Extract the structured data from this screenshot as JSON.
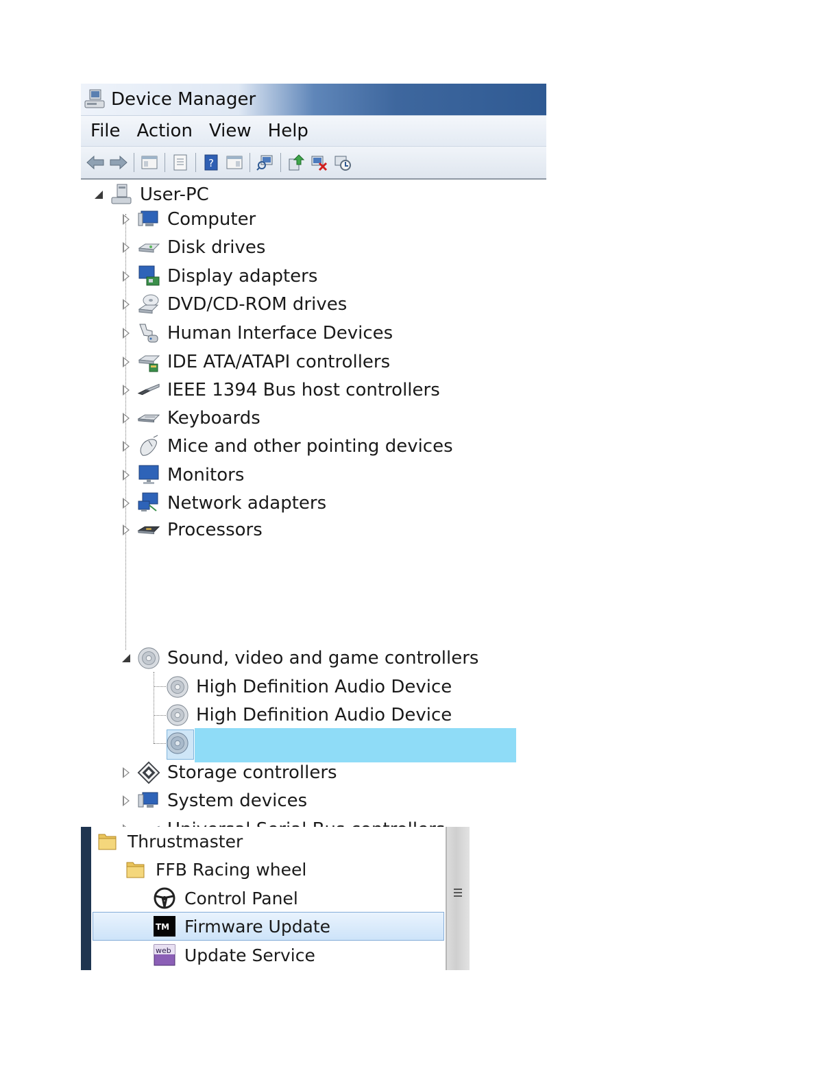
{
  "window": {
    "title": "Device Manager",
    "menu": [
      "File",
      "Action",
      "View",
      "Help"
    ],
    "toolbar_icons": [
      "back-arrow-icon",
      "forward-arrow-icon",
      "show-hide-console-tree-icon",
      "properties-icon",
      "help-icon",
      "action-pane-icon",
      "scan-hardware-icon",
      "update-driver-icon",
      "uninstall-icon",
      "disable-device-icon"
    ]
  },
  "tree": {
    "root": "User-PC",
    "categories": [
      {
        "label": "Computer",
        "icon": "computer-icon"
      },
      {
        "label": "Disk drives",
        "icon": "disk-drive-icon"
      },
      {
        "label": "Display adapters",
        "icon": "display-adapter-icon"
      },
      {
        "label": "DVD/CD-ROM drives",
        "icon": "dvd-drive-icon"
      },
      {
        "label": "Human Interface Devices",
        "icon": "hid-icon"
      },
      {
        "label": "IDE ATA/ATAPI controllers",
        "icon": "ide-controller-icon"
      },
      {
        "label": "IEEE 1394 Bus host controllers",
        "icon": "ieee1394-icon"
      },
      {
        "label": "Keyboards",
        "icon": "keyboard-icon"
      },
      {
        "label": "Mice and other pointing devices",
        "icon": "mouse-icon"
      },
      {
        "label": "Monitors",
        "icon": "monitor-icon"
      },
      {
        "label": "Network adapters",
        "icon": "network-adapter-icon"
      },
      {
        "label": "Processors",
        "icon": "processor-icon"
      },
      {
        "label": "Sound, video and game controllers",
        "icon": "speaker-icon",
        "expanded": true
      },
      {
        "label": "Storage controllers",
        "icon": "storage-controller-icon"
      },
      {
        "label": "System devices",
        "icon": "system-device-icon"
      },
      {
        "label": "Universal Serial Bus controllers",
        "icon": "usb-icon"
      }
    ],
    "sound_children": [
      "High Definition Audio Device",
      "High Definition Audio Device",
      ""
    ],
    "selection_color": "#8fdcf7"
  },
  "start_menu": {
    "items": [
      {
        "label": "Thrustmaster",
        "icon": "folder-icon"
      },
      {
        "label": "FFB Racing wheel",
        "icon": "folder-icon"
      },
      {
        "label": "Control Panel",
        "icon": "steering-wheel-icon"
      },
      {
        "label": "Firmware Update",
        "icon": "tm-logo-icon",
        "selected": true
      },
      {
        "label": "Update Service",
        "icon": "web-service-icon"
      }
    ]
  }
}
